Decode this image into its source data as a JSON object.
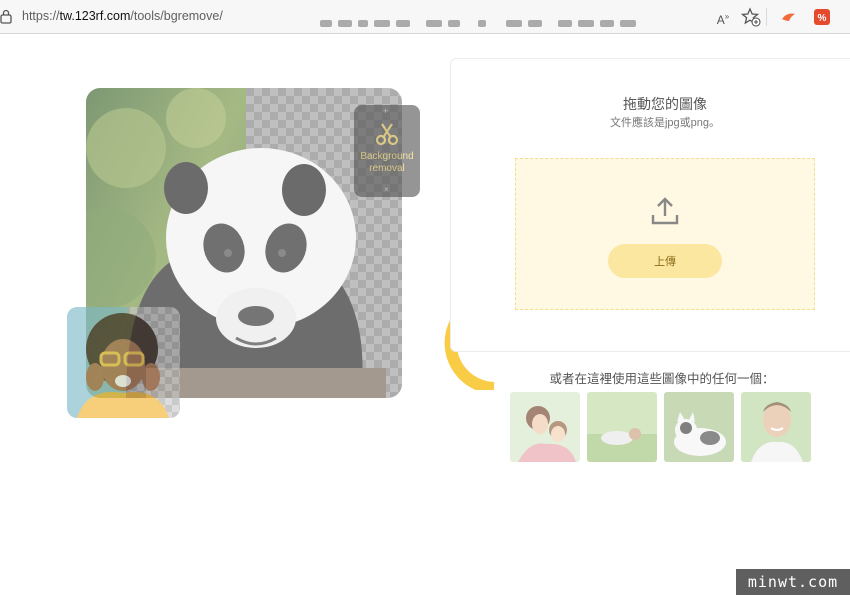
{
  "browser": {
    "url_prefix": "https://",
    "url_host": "tw.123rf.com",
    "url_path": "/tools/bgremove/",
    "reader_label": "A"
  },
  "page": {
    "hero_card": {
      "line1": "Background",
      "line2": "removal"
    },
    "upload": {
      "drag_title": "拖動您的圖像",
      "drag_subtitle": "文件應該是jpg或png。",
      "upload_button": "上傳"
    },
    "samples": {
      "label": "或者在這裡使用這些圖像中的任何一個：",
      "items": [
        "sample-mother-child",
        "sample-man-grass",
        "sample-cat",
        "sample-smiling-man"
      ]
    }
  },
  "watermark": "minwt.com",
  "colors": {
    "accent_yellow": "#f7c325",
    "dropzone_bg": "#fff8e2",
    "upload_button_bg": "#fce7a0"
  }
}
